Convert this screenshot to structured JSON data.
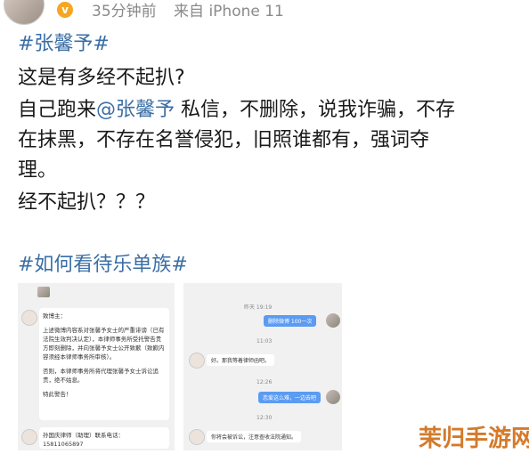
{
  "post": {
    "time": "35分钟前",
    "source": "来自 iPhone 11",
    "hashtag1": "#张馨予#",
    "line1": "这是有多经不起扒?",
    "line2a": "自己跑来",
    "line2_mention": "@张馨予",
    "line2b": " 私信，不删除，说我诈骗，不存",
    "line3": "在抹黑，不存在名誉侵犯，旧照谁都有，强词夺",
    "line4": "理。",
    "line5": "经不起扒？？？",
    "hashtag2": "#如何看待乐单族#"
  },
  "left_shot": {
    "greeting": "致博主：",
    "body": "上述微博内容系对张馨予女士的严重诽谤（已有法院生效判决认定），本律师事务所受托警告贵方即刻删除，并向张馨予女士公开致歉（致歉内容须经本律师事务所审核）。",
    "warning": "否则，本律师事务所将代理张馨予女士诉讼追责，绝不姑息。",
    "special": "特此警告！",
    "contact": "孙国庆律师（助理）联系电话：",
    "phone": "15811065897"
  },
  "right_shot": {
    "time1": "昨天 19:19",
    "msg1": "删除微博 100一次",
    "time2": "11:03",
    "msg2": "好。那我等着律师函吧。",
    "time3": "12:26",
    "msg3": "恋爱这么难，一边去吧",
    "time4": "12:30",
    "msg4": "你将会被诉讼，注意查收法院通知。"
  },
  "watermark": "茉归手游网"
}
